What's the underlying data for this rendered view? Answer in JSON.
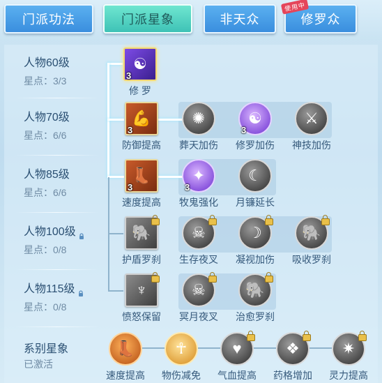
{
  "tabs": [
    {
      "label": "门派功法",
      "style": "blue"
    },
    {
      "label": "门派星象",
      "style": "green",
      "selected": true
    },
    {
      "label": "非天众",
      "style": "blue"
    },
    {
      "label": "修罗众",
      "style": "blue",
      "badge": "使用中"
    }
  ],
  "levels": [
    {
      "title": "人物60级",
      "stars": "星点：3/3",
      "locked": false
    },
    {
      "title": "人物70级",
      "stars": "星点：6/6",
      "locked": false
    },
    {
      "title": "人物85级",
      "stars": "星点：6/6",
      "locked": false
    },
    {
      "title": "人物100级",
      "stars": "星点：0/8",
      "locked": true
    },
    {
      "title": "人物115级",
      "stars": "星点：0/8",
      "locked": true
    }
  ],
  "nodes": {
    "row1": [
      {
        "label": "修 罗",
        "count": "3",
        "icon": "demon-icon",
        "color": "purple",
        "shape": "sq"
      }
    ],
    "row2": [
      {
        "label": "防御提高",
        "count": "3",
        "icon": "arm-icon",
        "color": "orange",
        "shape": "sq"
      },
      {
        "label": "葬天加伤",
        "count": "",
        "icon": "blast-icon",
        "color": "gray",
        "shape": "rd"
      },
      {
        "label": "修罗加伤",
        "count": "3",
        "icon": "demon-icon",
        "color": "purple",
        "shape": "rd"
      },
      {
        "label": "神技加伤",
        "count": "",
        "icon": "claw-icon",
        "color": "gray",
        "shape": "rd"
      }
    ],
    "row3": [
      {
        "label": "速度提高",
        "count": "3",
        "icon": "boot-icon",
        "color": "orange",
        "shape": "sq"
      },
      {
        "label": "牧鬼强化",
        "count": "3",
        "icon": "chest-icon",
        "color": "purple",
        "shape": "rd"
      },
      {
        "label": "月镰延长",
        "count": "",
        "icon": "scythe-icon",
        "color": "gray",
        "shape": "rd"
      }
    ],
    "row4": [
      {
        "label": "护盾罗刹",
        "count": "",
        "icon": "beast-icon",
        "color": "gray",
        "shape": "sq",
        "locked": true
      },
      {
        "label": "生存夜叉",
        "count": "",
        "icon": "beast-icon",
        "color": "gray",
        "shape": "rd",
        "locked": true
      },
      {
        "label": "凝视加伤",
        "count": "",
        "icon": "moon-icon",
        "color": "gray",
        "shape": "rd",
        "locked": true
      },
      {
        "label": "吸收罗刹",
        "count": "",
        "icon": "beast-icon",
        "color": "gray",
        "shape": "rd",
        "locked": true
      }
    ],
    "row5": [
      {
        "label": "愤怒保留",
        "count": "",
        "icon": "demon-figure-icon",
        "color": "gray",
        "shape": "sq",
        "locked": true
      },
      {
        "label": "冥月夜叉",
        "count": "",
        "icon": "beast-icon",
        "color": "gray",
        "shape": "rd",
        "locked": true
      },
      {
        "label": "治愈罗刹",
        "count": "",
        "icon": "beast-icon",
        "color": "gray",
        "shape": "rd",
        "locked": true
      }
    ]
  },
  "series": {
    "title": "系别星象",
    "status": "已激活",
    "items": [
      {
        "label": "速度提高",
        "icon": "boot-icon",
        "color": "orange",
        "locked": false
      },
      {
        "label": "物伤减免",
        "icon": "figure-icon",
        "color": "gold",
        "locked": false
      },
      {
        "label": "气血提高",
        "icon": "heart-icon",
        "color": "gray",
        "locked": true
      },
      {
        "label": "药格增加",
        "icon": "crystal-icon",
        "color": "gray",
        "locked": true
      },
      {
        "label": "灵力提高",
        "icon": "spark-icon",
        "color": "gray",
        "locked": true
      }
    ]
  },
  "colors": {
    "accent_green": "#3ec2b6",
    "tab_blue": "#3a8ede",
    "text_dark": "#2a4f72",
    "text_muted": "#6f8ba4"
  }
}
